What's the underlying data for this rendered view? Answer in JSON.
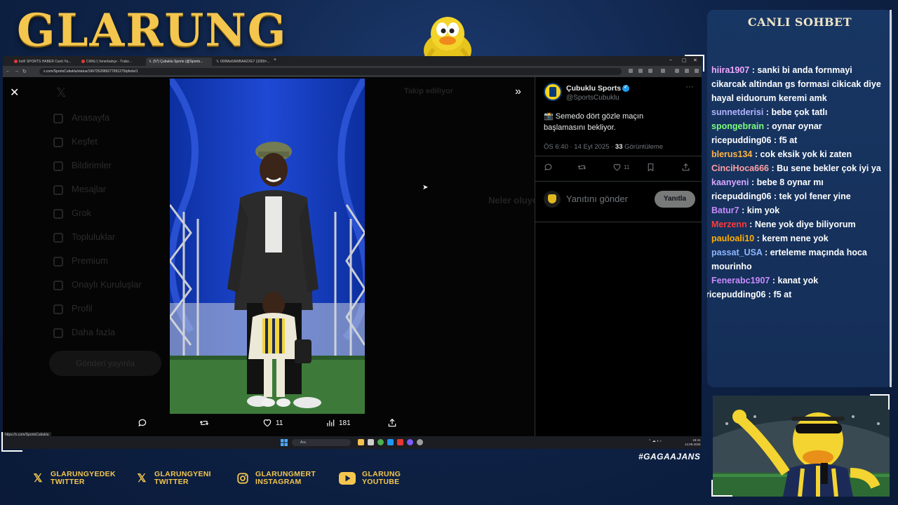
{
  "overlay": {
    "logo_text": "GLARUNG",
    "chat_title": "CANLI SOHBET",
    "hashtag": "#GAGAAJANS",
    "socials": [
      {
        "icon": "x-icon",
        "line1": "GLARUNGYEDEK",
        "line2": "TWITTER"
      },
      {
        "icon": "x-icon",
        "line1": "GLARUNGYENI",
        "line2": "TWITTER"
      },
      {
        "icon": "instagram-icon",
        "line1": "GLARUNGMERT",
        "line2": "INSTAGRAM"
      },
      {
        "icon": "youtube-icon",
        "line1": "GLARUNG",
        "line2": "YOUTUBE"
      }
    ],
    "brand_color": "#f4c64e"
  },
  "browser": {
    "tabs": [
      {
        "label": "bolt! SPORTS HABER Canlı Ya...",
        "color": "#e53935"
      },
      {
        "label": "CANLI | fenerbahçe - Trabz...",
        "color": "#e53935"
      },
      {
        "label": "(57) Çubuklu Sports (@Sports...",
        "color": "#ffffff"
      },
      {
        "label": "000Mw5AWBAAZXE7 (3289×...",
        "color": "#ffffff"
      }
    ],
    "url": "x.com/SportsCubuklu/status/1967252089277951275/photo/1",
    "status_url": "https://x.com/SportsCubuklu",
    "taskbar_search": "Ara",
    "clock_time": "18:41",
    "clock_date": "14.09.2025"
  },
  "x_page": {
    "dim_nav": [
      "Anasayfa",
      "Keşfet",
      "Bildirimler",
      "Mesajlar",
      "Grok",
      "Topluluklar",
      "Premium",
      "Onaylı Kuruluşlar",
      "Profil",
      "Daha fazla"
    ],
    "dim_post_button": "Gönderi yayınla",
    "dim_follow": "Takip ediliyor",
    "dim_trends": "Neler oluyor",
    "photo_actions": {
      "likes": "11",
      "views": "181"
    }
  },
  "tweet": {
    "display_name": "Çubuklu Sports",
    "handle": "@SportsCubuklu",
    "body_line1": "📸 Semedo dört gözle maçın",
    "body_line2": "başlamasını bekliyor.",
    "timestamp": "ÖS 6:40 · 14 Eyl 2025 · ",
    "views_count": "33",
    "views_label": " Görüntüleme",
    "like_count": "11",
    "reply_placeholder": "Yanıtını gönder",
    "reply_button": "Yanıtla"
  },
  "chat": {
    "messages": [
      {
        "user": "hiira1907",
        "color": "#f3a7ff",
        "text": "sanki bi anda fornmayi cikarcak altindan gs formasi cikicak diye hayal eiduorum keremi amk"
      },
      {
        "user": "sunnetderisi",
        "color": "#b3b3ff",
        "text": "bebe çok tatlı"
      },
      {
        "user": "spongebrain",
        "color": "#7cff7c",
        "text": "oynar oynar"
      },
      {
        "user": "ricepudding06",
        "color": "#ffffff",
        "text": "f5 at"
      },
      {
        "user": "blerus134",
        "color": "#ffb347",
        "text": "cok eksik yok ki zaten"
      },
      {
        "user": "CinciHoca666",
        "color": "#ffa0a0",
        "text": "Bu sene bekler çok iyi ya"
      },
      {
        "user": "kaanyeni",
        "color": "#d7a7ff",
        "text": "bebe 8 oynar mı"
      },
      {
        "user": "ricepudding06",
        "color": "#ffffff",
        "text": "tek yol fener yine"
      },
      {
        "user": "Batur7",
        "color": "#c98bff",
        "text": "kim yok"
      },
      {
        "user": "Merzenn",
        "color": "#ff3b3b",
        "text": "Nene yok diye biliyorum"
      },
      {
        "user": "pauloali10",
        "color": "#ffb000",
        "text": "kerem nene yok"
      },
      {
        "user": "passat_USA",
        "color": "#8fb6ff",
        "text": "erteleme maçında hoca mourinho"
      },
      {
        "user": "Fenerabc1907",
        "color": "#c98bff",
        "text": "kanat yok"
      },
      {
        "user": "ricepudding06",
        "color": "#ffffff",
        "text": "f5 at"
      }
    ]
  }
}
